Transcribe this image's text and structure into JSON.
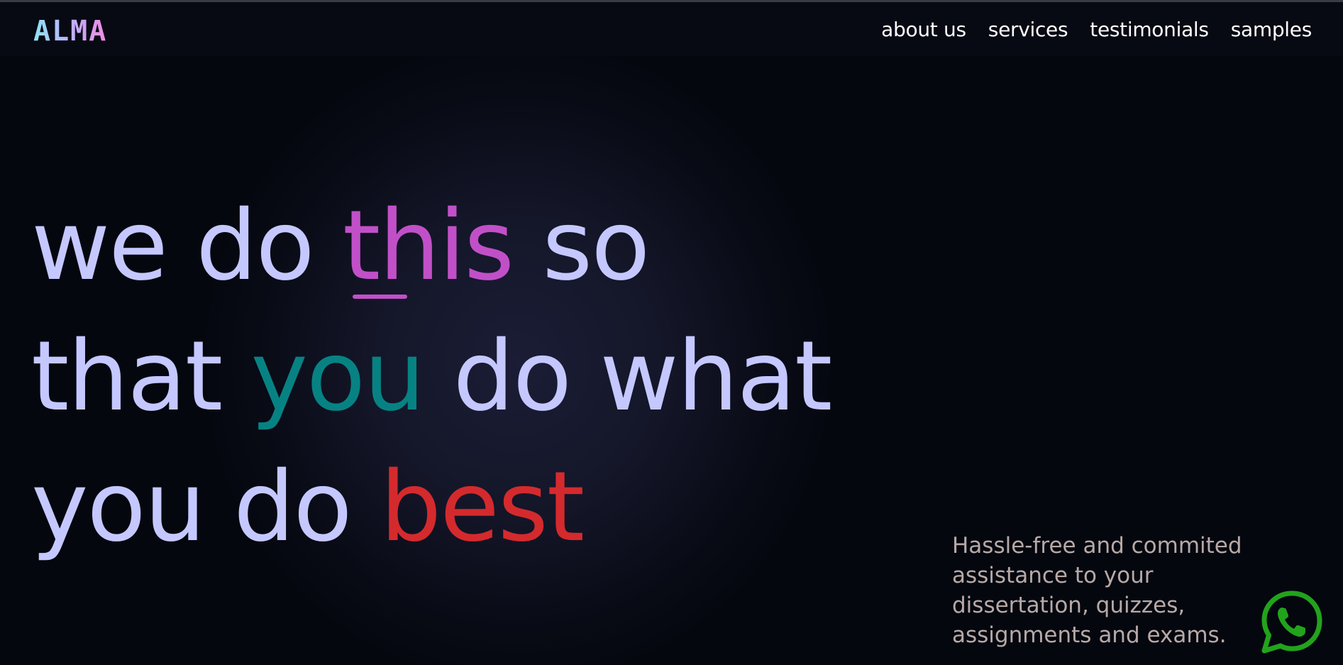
{
  "brand": {
    "logo": "ALMA"
  },
  "nav": {
    "items": [
      {
        "label": "about us"
      },
      {
        "label": "services"
      },
      {
        "label": "testimonials"
      },
      {
        "label": "samples"
      }
    ]
  },
  "hero": {
    "line1": {
      "a": "we do ",
      "highlight": "this",
      "b": " so"
    },
    "line2": {
      "a": "that ",
      "highlight": "you",
      "b": " do what"
    },
    "line3": {
      "a": "you do ",
      "highlight": "best"
    }
  },
  "tagline": "Hassle-free and commited assistance to your dissertation, quizzes, assignments and exams.",
  "icons": {
    "whatsapp": "whatsapp-icon"
  },
  "colors": {
    "background": "#05070f",
    "headline": "#c5c8ff",
    "this": "#c150c8",
    "you": "#078283",
    "best": "#d42a2d",
    "tagline": "#b7a9a6",
    "whatsapp": "#22a31c"
  }
}
